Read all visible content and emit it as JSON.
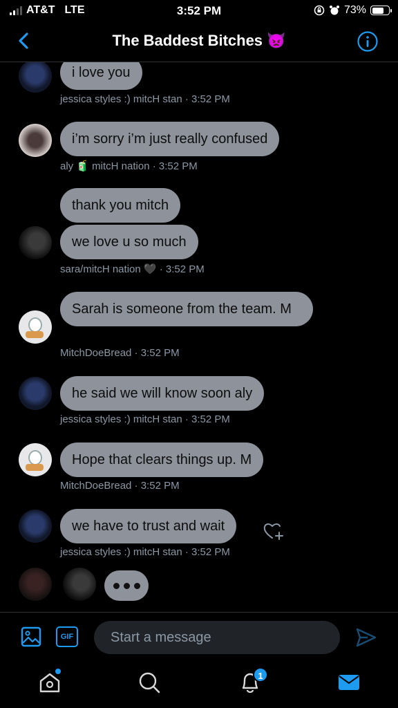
{
  "status_bar": {
    "carrier": "AT&T",
    "network": "LTE",
    "time": "3:52 PM",
    "battery": "73%",
    "battery_level": 0.73
  },
  "header": {
    "title": "The Baddest Bitches 👿",
    "back_icon": "chevron-left-icon",
    "info_icon": "info-icon"
  },
  "messages": [
    {
      "text": "i love you",
      "meta": "jessica styles :) mitcH stan · 3:52 PM"
    },
    {
      "text": "i’m sorry i’m just really confused",
      "meta": "aly 🧃 mitcH nation · 3:52 PM"
    },
    {
      "text": "thank you mitch",
      "meta": ""
    },
    {
      "text": "we love u so much",
      "meta": "sara/mitcH nation 🖤 · 3:52 PM"
    },
    {
      "text": "Sarah is someone from the team. M",
      "meta": "MitchDoeBread · 3:52 PM"
    },
    {
      "text": "he said we will know soon aly",
      "meta": "jessica styles :) mitcH stan · 3:52 PM"
    },
    {
      "text": "Hope that clears things up. M",
      "meta": "MitchDoeBread · 3:52 PM"
    },
    {
      "text": "we have to trust and wait",
      "meta": "jessica styles :) mitcH stan · 3:52 PM"
    }
  ],
  "composer": {
    "placeholder": "Start a message",
    "gif_label": "GIF"
  },
  "tabbar": {
    "notifications_count": "1"
  },
  "colors": {
    "accent": "#1d9bf0",
    "bubble": "#8e929a",
    "meta_text": "#8b98a5",
    "background": "#000000"
  }
}
